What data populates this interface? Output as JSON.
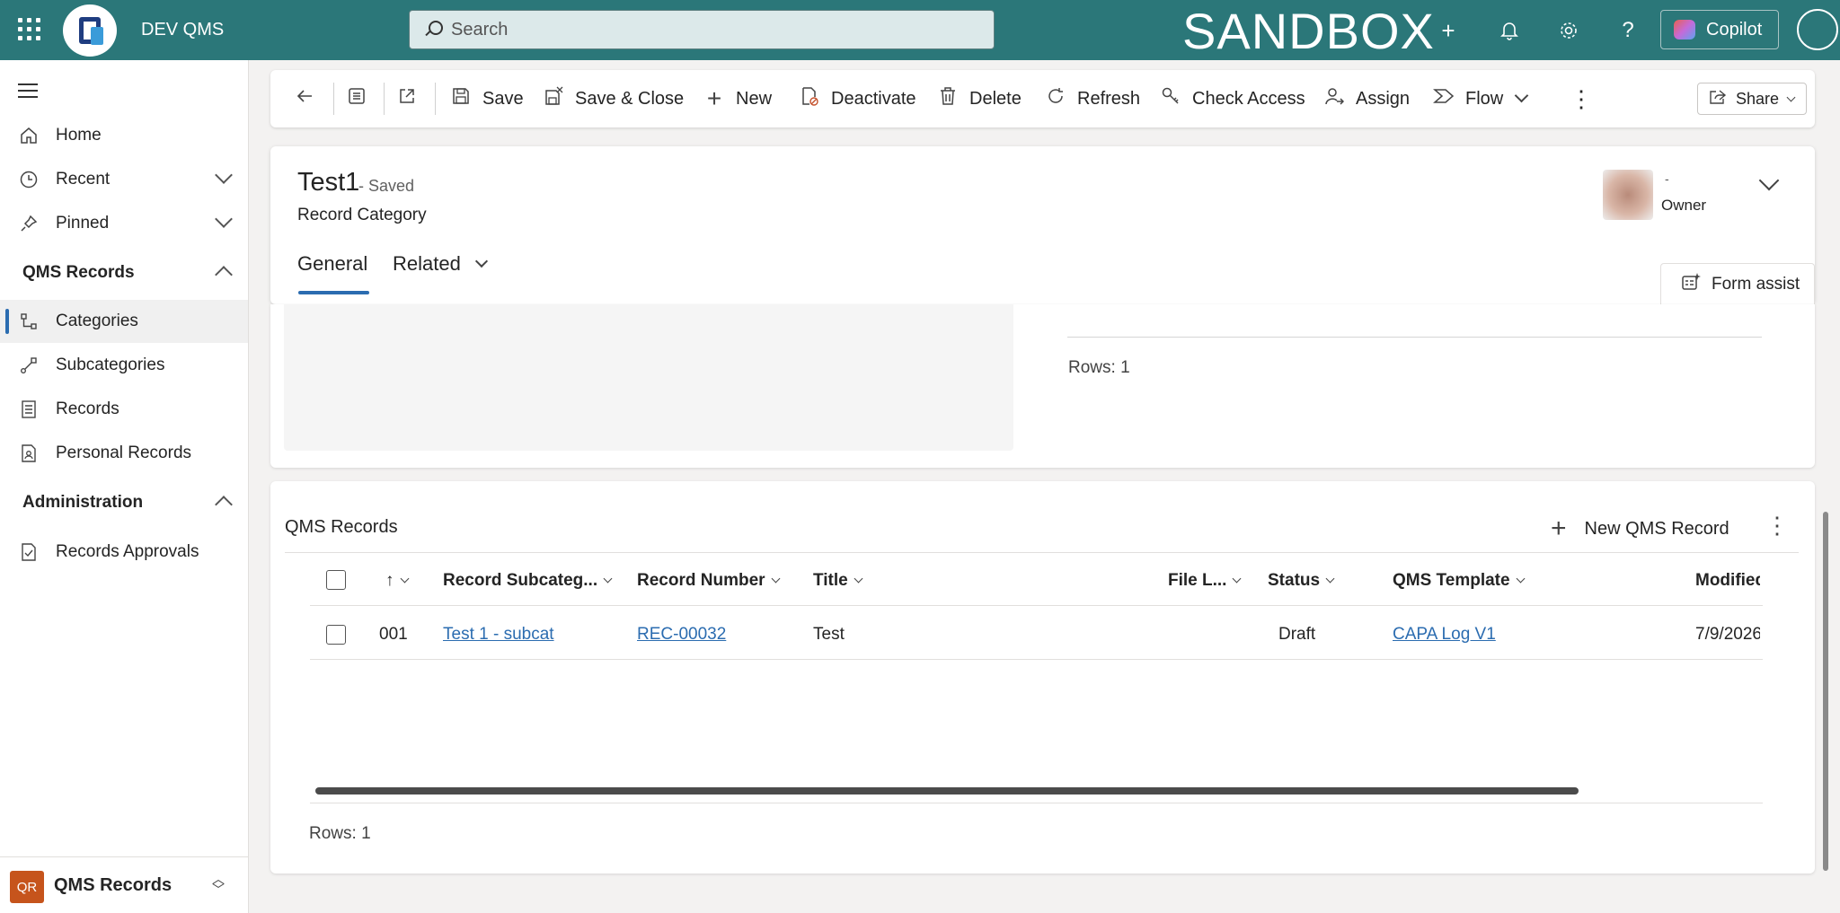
{
  "header": {
    "app_name": "DEV QMS",
    "search_placeholder": "Search",
    "environment_label": "SANDBOX",
    "copilot_label": "Copilot",
    "icons": [
      "waffle-icon",
      "plus-icon",
      "bell-icon",
      "gear-icon",
      "help-icon"
    ]
  },
  "sidebar": {
    "items": [
      {
        "label": "Home",
        "icon": "home-icon"
      },
      {
        "label": "Recent",
        "icon": "clock-icon"
      },
      {
        "label": "Pinned",
        "icon": "pin-icon"
      }
    ],
    "sections": [
      {
        "title": "QMS Records",
        "items": [
          {
            "label": "Categories",
            "icon": "categories-icon",
            "active": true
          },
          {
            "label": "Subcategories",
            "icon": "subcategories-icon"
          },
          {
            "label": "Records",
            "icon": "records-icon"
          },
          {
            "label": "Personal Records",
            "icon": "personal-records-icon"
          }
        ]
      },
      {
        "title": "Administration",
        "items": [
          {
            "label": "Records Approvals",
            "icon": "approvals-icon"
          }
        ]
      }
    ],
    "area_badge": "QR",
    "area_label": "QMS Records"
  },
  "commands": {
    "save": "Save",
    "save_close": "Save & Close",
    "new": "New",
    "deactivate": "Deactivate",
    "delete": "Delete",
    "refresh": "Refresh",
    "check_access": "Check Access",
    "assign": "Assign",
    "flow": "Flow",
    "share": "Share"
  },
  "record": {
    "title": "Test1",
    "save_status": "- Saved",
    "entity": "Record Category",
    "owner_name": "-",
    "owner_label": "Owner",
    "tabs": [
      "General",
      "Related"
    ],
    "form_assist": "Form assist"
  },
  "upper_section": {
    "rows_label": "Rows: 1"
  },
  "grid": {
    "title": "QMS Records",
    "new_button": "New QMS Record",
    "columns": [
      "Record Subcateg...",
      "Record Number",
      "Title",
      "File L...",
      "Status",
      "QMS Template",
      "Modified"
    ],
    "rows": [
      {
        "seq": "001",
        "subcategory": "Test 1 - subcat",
        "record_number": "REC-00032",
        "title": "Test",
        "file_l": "",
        "status": "Draft",
        "template": "CAPA Log V1",
        "modified": "7/9/2026"
      }
    ],
    "rows_label": "Rows: 1"
  }
}
